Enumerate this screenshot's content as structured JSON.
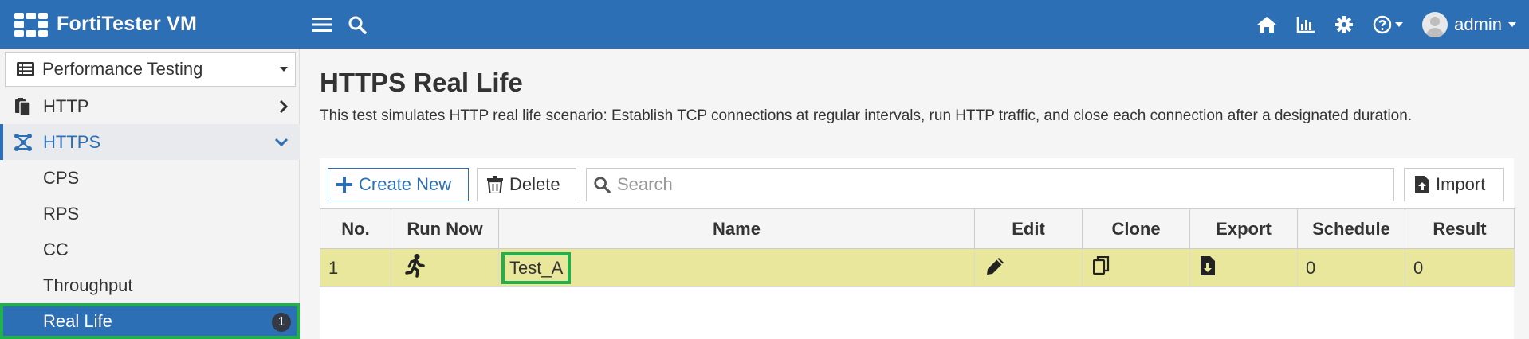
{
  "app": {
    "title": "FortiTester VM",
    "user": "admin"
  },
  "topbar_icons": [
    "menu-icon",
    "search-icon",
    "home-icon",
    "chart-icon",
    "gear-icon",
    "help-icon"
  ],
  "sidebar": {
    "module": "Performance Testing",
    "items": [
      {
        "label": "HTTP"
      },
      {
        "label": "HTTPS"
      }
    ],
    "sub_items": [
      {
        "label": "CPS"
      },
      {
        "label": "RPS"
      },
      {
        "label": "CC"
      },
      {
        "label": "Throughput"
      },
      {
        "label": "Real Life",
        "badge": "1"
      }
    ]
  },
  "page": {
    "title": "HTTPS Real Life",
    "description": "This test simulates HTTP real life scenario: Establish TCP connections at regular intervals, run HTTP traffic, and close each connection after a designated duration."
  },
  "toolbar": {
    "create_label": "Create New",
    "delete_label": "Delete",
    "search_placeholder": "Search",
    "import_label": "Import"
  },
  "table": {
    "headers": [
      "No.",
      "Run Now",
      "Name",
      "Edit",
      "Clone",
      "Export",
      "Schedule",
      "Result"
    ],
    "rows": [
      {
        "no": "1",
        "name": "Test_A",
        "schedule": "0",
        "result": "0"
      }
    ]
  },
  "colors": {
    "brand": "#2d6fb5",
    "row_highlight": "#e8e79c",
    "focus_outline": "#21b04b"
  }
}
